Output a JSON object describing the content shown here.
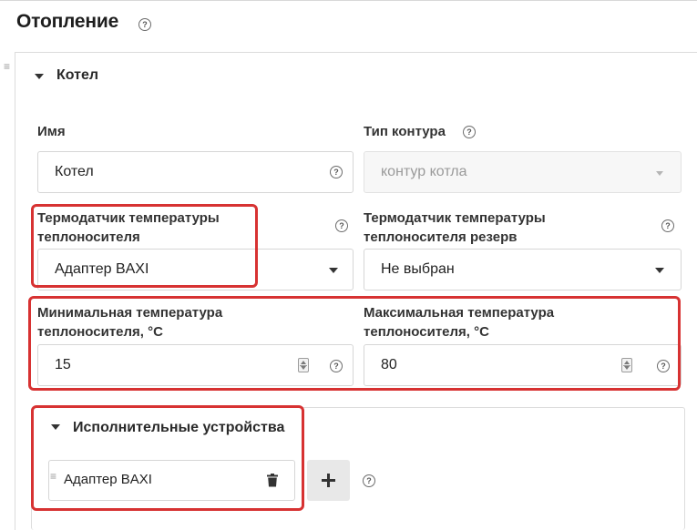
{
  "page": {
    "title": "Отопление"
  },
  "section": {
    "title": "Котел"
  },
  "fields": {
    "name": {
      "label": "Имя",
      "value": "Котел"
    },
    "circuit_type": {
      "label": "Тип контура",
      "value": "контур котла"
    },
    "sensor": {
      "label_line1": "Термодатчик температуры",
      "label_line2": "теплоносителя",
      "value": "Адаптер BAXI"
    },
    "sensor_reserve": {
      "label_line1": "Термодатчик температуры",
      "label_line2": "теплоносителя резерв",
      "value": "Не выбран"
    },
    "min_temp": {
      "label_line1": "Минимальная температура",
      "label_line2": "теплоносителя, °C",
      "value": "15"
    },
    "max_temp": {
      "label_line1": "Максимальная температура",
      "label_line2": "теплоносителя, °C",
      "value": "80"
    }
  },
  "actuators": {
    "title": "Исполнительные устройства",
    "items": [
      {
        "label": "Адаптер BAXI"
      }
    ]
  },
  "icons": {
    "help": "question-circle-icon",
    "drag": "drag-handle-icon",
    "caret": "caret-down-icon",
    "trash": "trash-icon",
    "plus": "plus-icon"
  },
  "colors": {
    "highlight": "#d73232",
    "button_bg": "#e8e8e8"
  }
}
